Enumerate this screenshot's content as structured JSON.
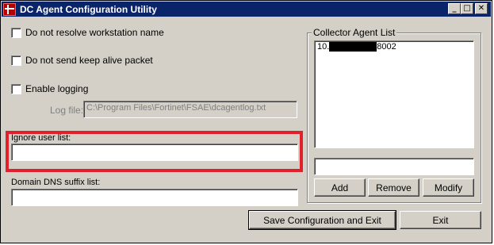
{
  "window": {
    "title": "DC Agent Configuration Utility",
    "controls": {
      "minimize": "_",
      "maximize": "□",
      "close": "✕"
    },
    "icon": "fortinet-logo-icon"
  },
  "options": {
    "no_resolve_label": "Do not resolve workstation name",
    "no_keepalive_label": "Do not send keep alive packet",
    "enable_logging_label": "Enable logging"
  },
  "log_file": {
    "label": "Log file:",
    "value": "C:\\Program Files\\Fortinet\\FSAE\\dcagentlog.txt"
  },
  "ignore_user_list": {
    "label": "Ignore user list:",
    "value": ""
  },
  "domain_dns": {
    "label": "Domain DNS suffix list:",
    "value": ""
  },
  "collector": {
    "title": "Collector Agent List",
    "items": [
      {
        "prefix": "10.",
        "suffix": "8002"
      }
    ],
    "input_value": "",
    "add_label": "Add",
    "remove_label": "Remove",
    "modify_label": "Modify"
  },
  "footer": {
    "save_label": "Save Configuration and Exit",
    "exit_label": "Exit"
  },
  "colors": {
    "titlebar": "#0a246a",
    "face": "#d4d0c8",
    "highlight_annotation": "#e0202a"
  }
}
